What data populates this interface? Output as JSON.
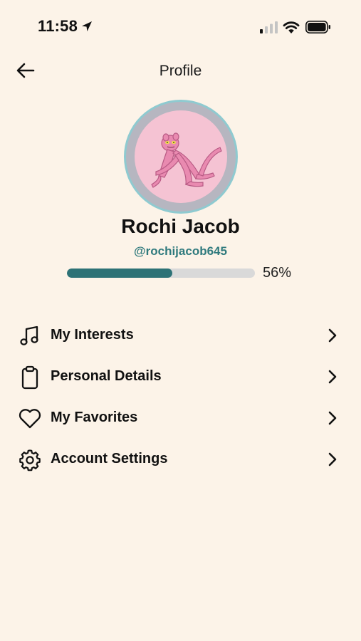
{
  "status_bar": {
    "time": "11:58"
  },
  "header": {
    "title": "Profile"
  },
  "profile": {
    "name": "Rochi Jacob",
    "handle": "@rochijacob645",
    "progress_label": "56%",
    "progress_fraction": 0.56
  },
  "menu": {
    "items": [
      {
        "label": "My Interests",
        "icon": "music-note-icon"
      },
      {
        "label": "Personal Details",
        "icon": "clipboard-icon"
      },
      {
        "label": "My Favorites",
        "icon": "heart-icon"
      },
      {
        "label": "Account Settings",
        "icon": "gear-icon"
      }
    ]
  },
  "colors": {
    "background": "#fcf3e8",
    "accent": "#2d7276",
    "handle": "#2f7a7d",
    "track": "#d9d9d9",
    "avatar_bg": "#f5c3d3"
  }
}
